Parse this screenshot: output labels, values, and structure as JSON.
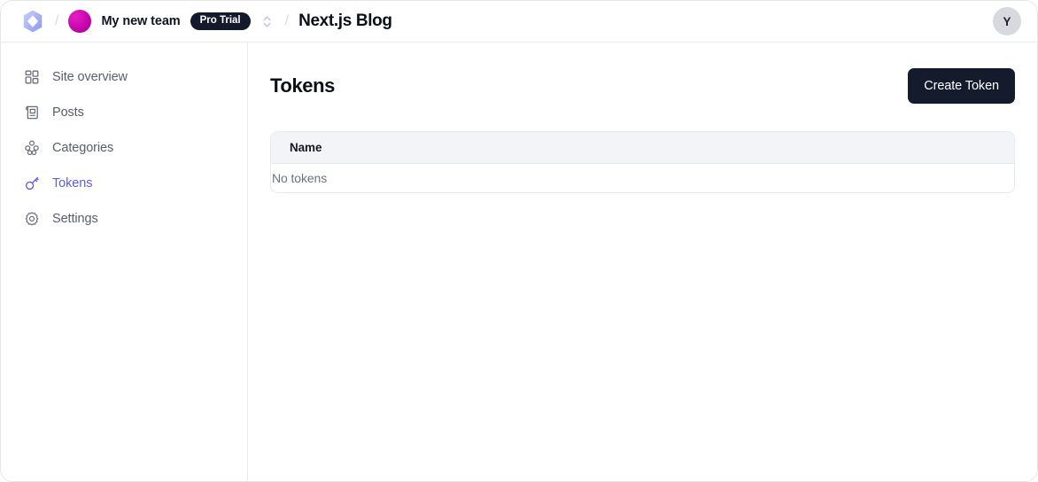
{
  "topbar": {
    "logo_icon": "hexagon-diamond-logo",
    "separator": "/",
    "team_avatar_icon": "team-avatar",
    "team_name": "My new team",
    "plan_badge": "Pro Trial",
    "switcher_icon": "chevron-up-down-icon",
    "site_title": "Next.js Blog",
    "user_avatar_initial": "Y"
  },
  "sidebar": {
    "items": [
      {
        "label": "Site overview",
        "icon": "dashboard-grid-icon",
        "active": false
      },
      {
        "label": "Posts",
        "icon": "article-icon",
        "active": false
      },
      {
        "label": "Categories",
        "icon": "hierarchy-icon",
        "active": false
      },
      {
        "label": "Tokens",
        "icon": "key-icon",
        "active": true
      },
      {
        "label": "Settings",
        "icon": "gear-icon",
        "active": false
      }
    ]
  },
  "main": {
    "title": "Tokens",
    "create_button": "Create Token",
    "table": {
      "columns": [
        "Name"
      ],
      "empty_message": "No tokens",
      "rows": []
    }
  },
  "colors": {
    "accent": "#5a5fe0",
    "button_dark": "#131b2c",
    "badge_dark": "#121a2b",
    "table_header_bg": "#f3f4f7",
    "border": "#e9eaed",
    "team_avatar": "#d40fb6"
  }
}
